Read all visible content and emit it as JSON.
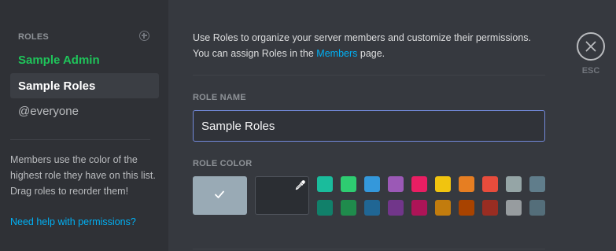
{
  "sidebar": {
    "header": "ROLES",
    "add_icon": "plus-circle-icon",
    "roles": [
      {
        "label": "Sample Admin",
        "color": "#1fc45a",
        "selected": false
      },
      {
        "label": "Sample Roles",
        "color": "#ffffff",
        "selected": true
      },
      {
        "label": "@everyone",
        "color": "#b9bbbe",
        "selected": false
      }
    ],
    "help_text": "Members use the color of the highest role they have on this list. Drag roles to reorder them!",
    "help_link": "Need help with permissions?"
  },
  "main": {
    "intro_line1": "Use Roles to organize your server members and customize their permissions.",
    "intro_line2_before": "You can assign Roles in the ",
    "intro_link": "Members",
    "intro_line2_after": " page.",
    "role_name_label": "ROLE NAME",
    "role_name_value": "Sample Roles",
    "role_color_label": "ROLE COLOR",
    "default_color": "#99aab5",
    "selected_icon": "checkmark-icon",
    "custom_icon": "eyedropper-icon",
    "swatches_row1": [
      "#1abc9c",
      "#2ecc71",
      "#3498db",
      "#9b59b6",
      "#e91e63",
      "#f1c40f",
      "#e67e22",
      "#e74c3c",
      "#95a5a6",
      "#607d8b"
    ],
    "swatches_row2": [
      "#11806a",
      "#1f8b4c",
      "#206694",
      "#71368a",
      "#ad1457",
      "#c27c0e",
      "#a84300",
      "#992d22",
      "#979c9f",
      "#546e7a"
    ]
  },
  "close": {
    "icon": "close-icon",
    "label": "ESC"
  },
  "colors": {
    "accent_link": "#00b0f4",
    "input_focus_border": "#7289da"
  }
}
